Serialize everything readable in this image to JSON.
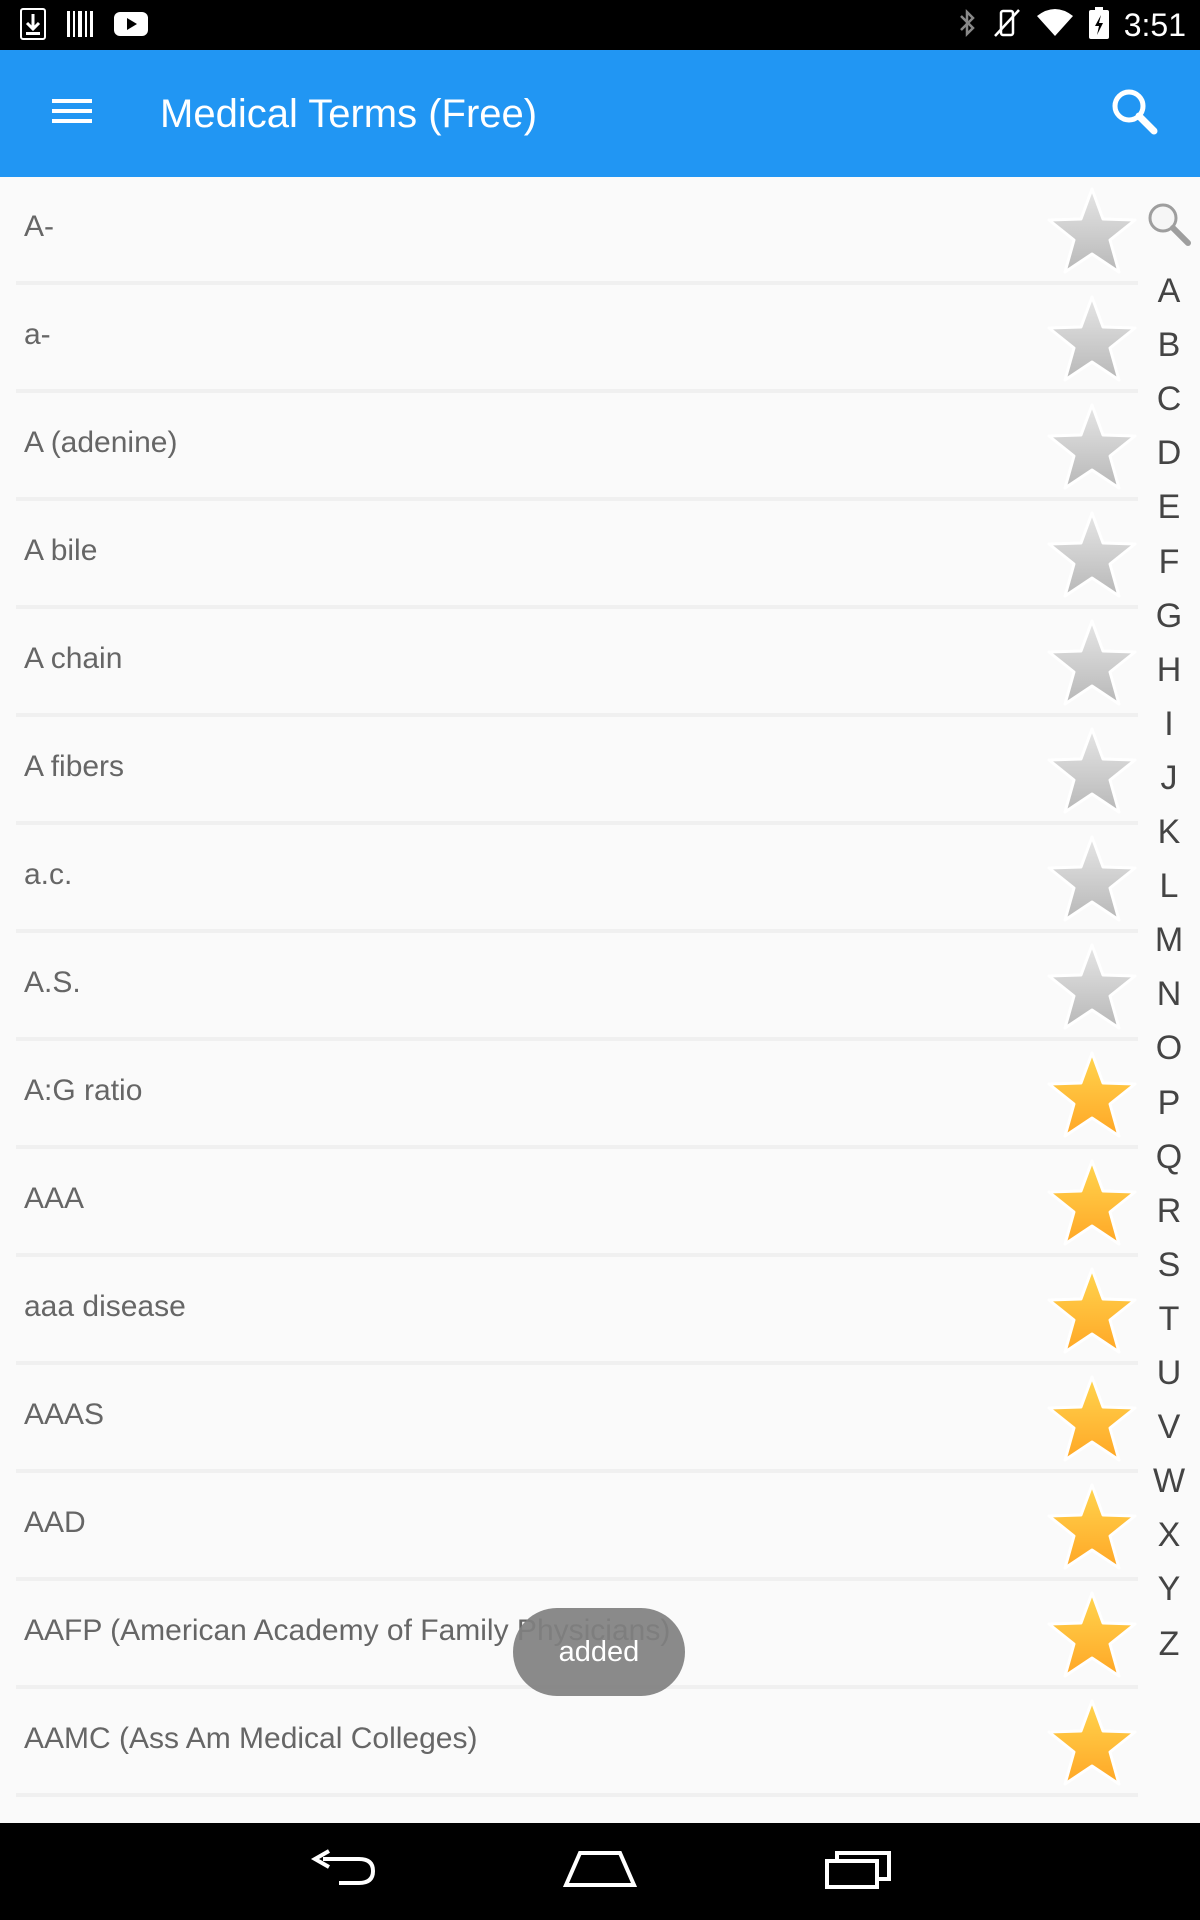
{
  "status_bar": {
    "time": "3:51",
    "left_icons": [
      "download-icon",
      "barcode-icon",
      "youtube-icon"
    ],
    "right_icons": [
      "bluetooth-icon",
      "vibrate-off-icon",
      "wifi-icon",
      "battery-charging-icon"
    ]
  },
  "app_bar": {
    "title": "Medical Terms (Free)",
    "background": "#2196f3"
  },
  "terms": [
    {
      "label": "A-",
      "starred": false
    },
    {
      "label": "a-",
      "starred": false
    },
    {
      "label": "A (adenine)",
      "starred": false
    },
    {
      "label": "A bile",
      "starred": false
    },
    {
      "label": "A chain",
      "starred": false
    },
    {
      "label": "A fibers",
      "starred": false
    },
    {
      "label": "a.c.",
      "starred": false
    },
    {
      "label": "A.S.",
      "starred": false
    },
    {
      "label": "A:G ratio",
      "starred": true
    },
    {
      "label": "AAA",
      "starred": true
    },
    {
      "label": "aaa disease",
      "starred": true
    },
    {
      "label": "AAAS",
      "starred": true
    },
    {
      "label": "AAD",
      "starred": true
    },
    {
      "label": "AAFP (American Academy of Family Physicians)",
      "starred": true
    },
    {
      "label": "AAMC (Ass Am Medical Colleges)",
      "starred": true
    }
  ],
  "alphabet_index": [
    "A",
    "B",
    "C",
    "D",
    "E",
    "F",
    "G",
    "H",
    "I",
    "J",
    "K",
    "L",
    "M",
    "N",
    "O",
    "P",
    "Q",
    "R",
    "S",
    "T",
    "U",
    "V",
    "W",
    "X",
    "Y",
    "Z"
  ],
  "toast": {
    "message": "added"
  },
  "colors": {
    "star_off": "#b8b8b8",
    "star_on": "#ffa726"
  }
}
